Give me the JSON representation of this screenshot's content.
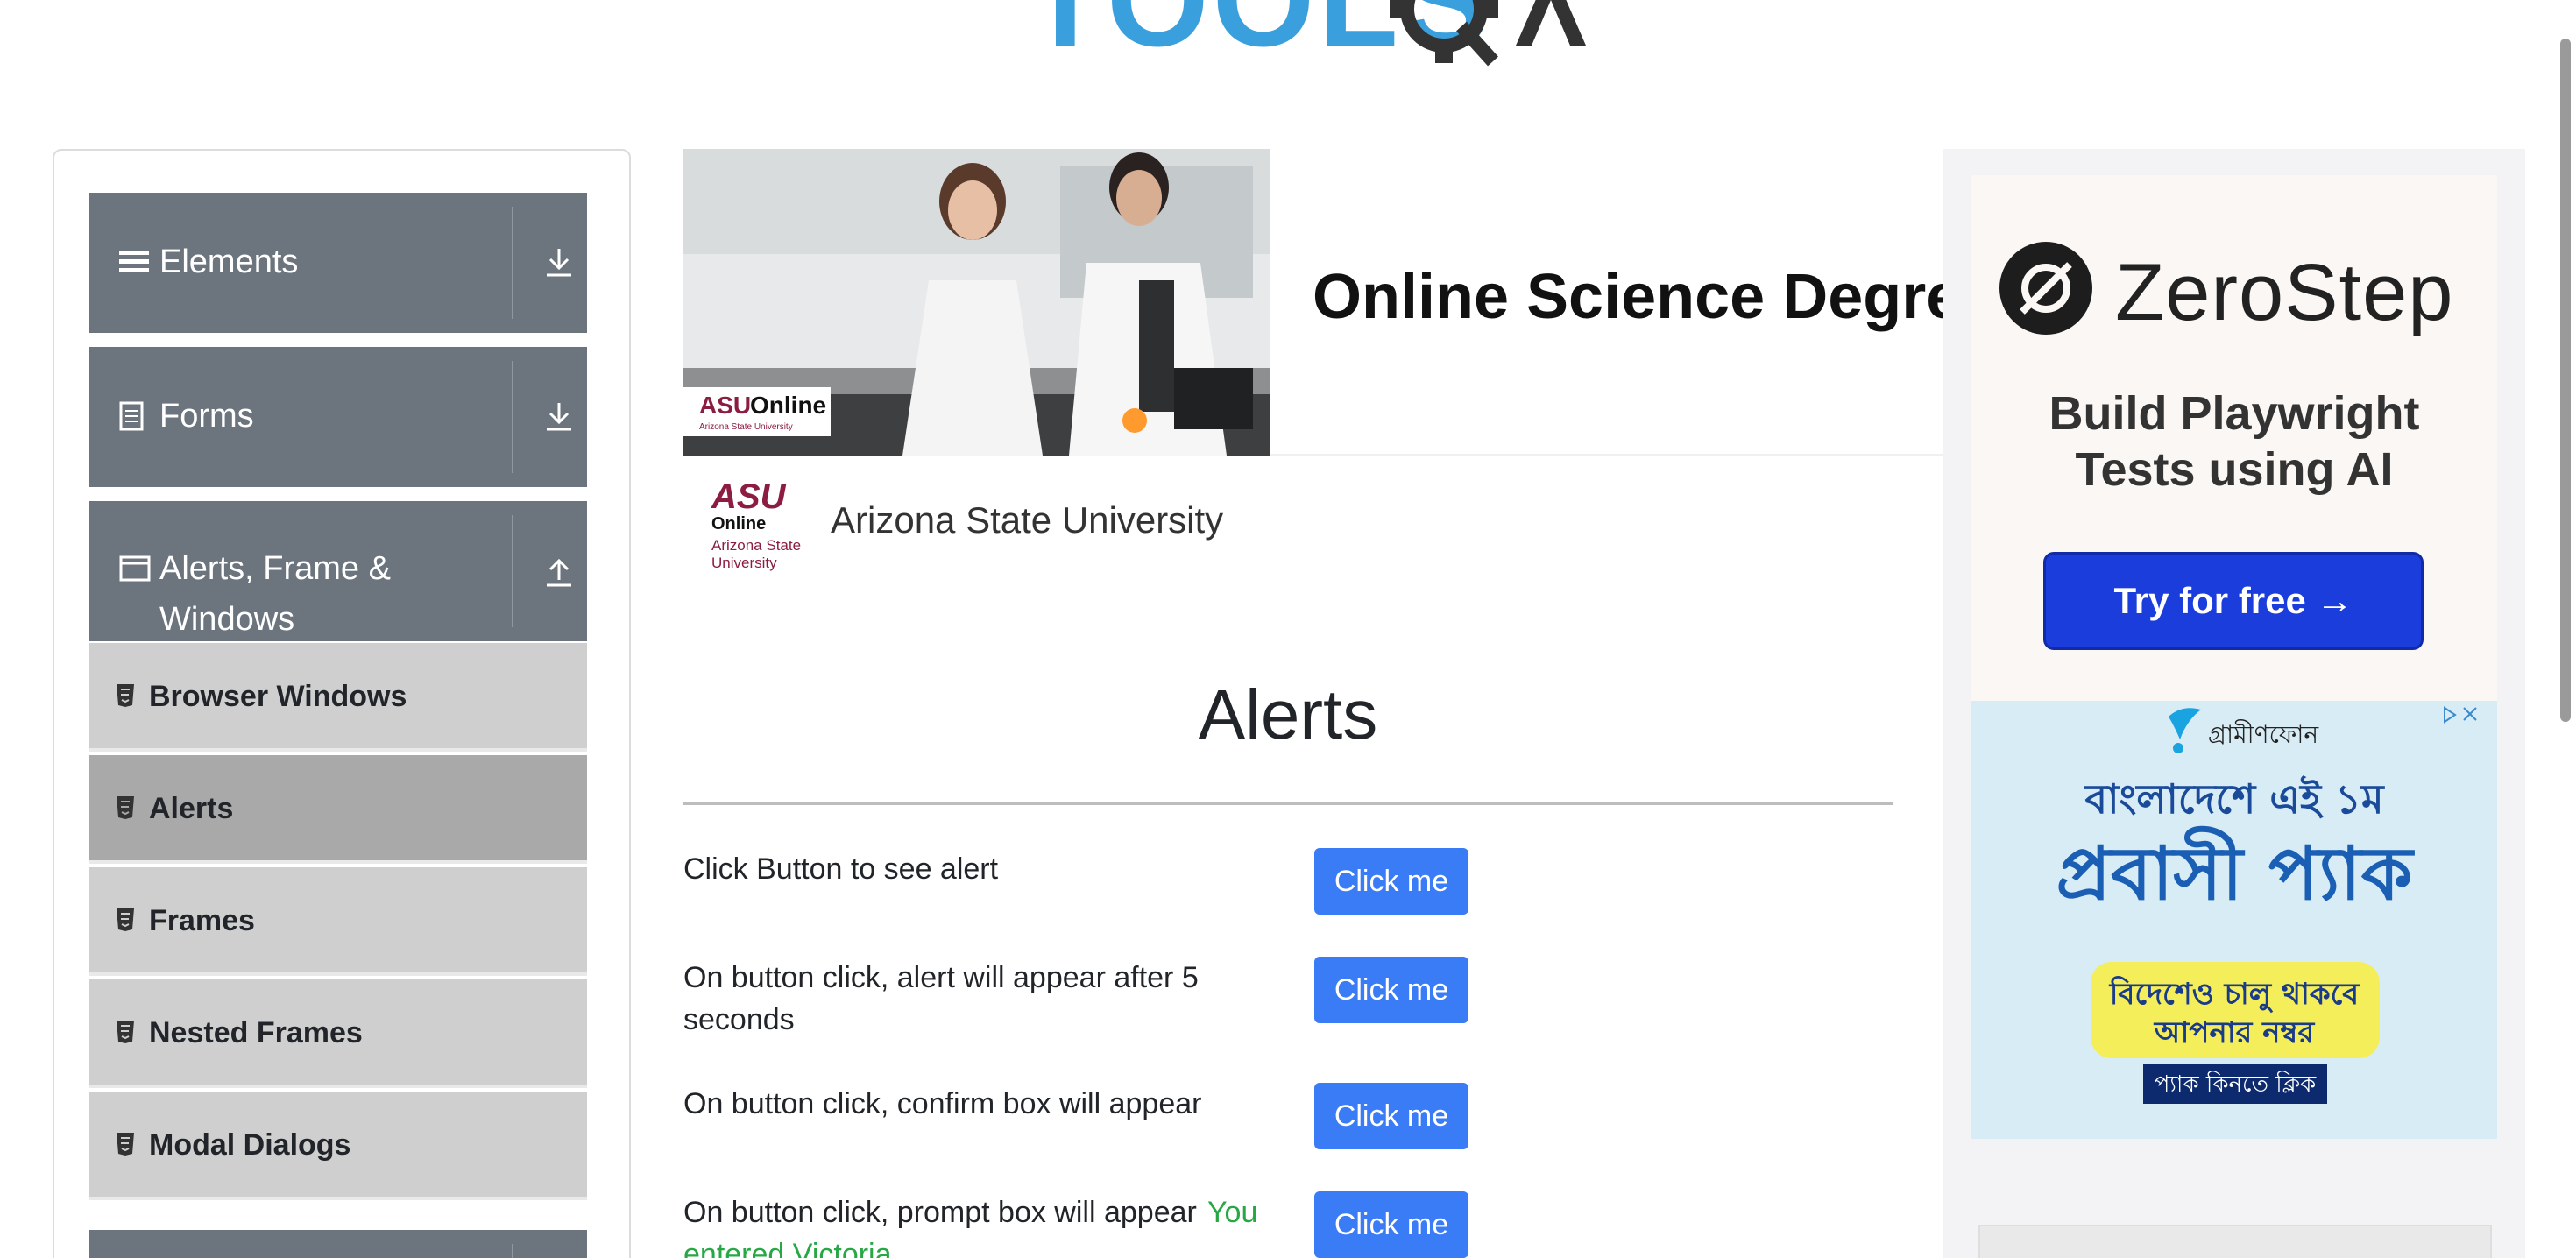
{
  "logo": {
    "text": "TOOLSQA"
  },
  "sidebar": {
    "groups": [
      {
        "label": "Elements",
        "icon": "list-icon",
        "toggle": "download-icon"
      },
      {
        "label": "Forms",
        "icon": "form-icon",
        "toggle": "download-icon"
      },
      {
        "label_line1": "Alerts, Frame &",
        "label_line2": "Windows",
        "icon": "window-icon",
        "toggle": "upload-icon"
      }
    ],
    "items": [
      {
        "label": "Browser Windows"
      },
      {
        "label": "Alerts"
      },
      {
        "label": "Frames"
      },
      {
        "label": "Nested Frames"
      },
      {
        "label": "Modal Dialogs"
      }
    ]
  },
  "ad": {
    "title": "Online Science Degree",
    "advertiser": "Arizona State University",
    "badge": "ASU Online",
    "badge_sub": "Arizona State University",
    "logo_line1": "Online",
    "logo_line2": "Arizona State",
    "logo_line3": "University"
  },
  "main": {
    "heading": "Alerts",
    "rows": [
      {
        "text": "Click Button to see alert",
        "button": "Click me"
      },
      {
        "text": "On button click, alert will appear after 5 seconds",
        "button": "Click me"
      },
      {
        "text": "On button click, confirm box will appear",
        "button": "Click me"
      },
      {
        "text": "On button click, prompt box will appear",
        "button": "Click me",
        "result": "You entered Victoria"
      }
    ]
  },
  "right_ad": {
    "brand": "ZeroStep",
    "tagline_line1": "Build Playwright",
    "tagline_line2": "Tests using AI",
    "cta": "Try for free →",
    "gp_brand": "গ্রামীণফোন",
    "gp_line1": "বাংলাদেশে এই ১ম",
    "gp_line2": "প্রবাসী প্যাক",
    "gp_line3": "বিদেশেও চালু থাকবে",
    "gp_line4": "আপনার নম্বর",
    "gp_cta": "প্যাক কিনতে ক্লিক"
  },
  "colors": {
    "button": "#3a7bf6",
    "sidebar_header": "#6c757d",
    "success": "#28a745",
    "cta": "#1b3ddb"
  }
}
